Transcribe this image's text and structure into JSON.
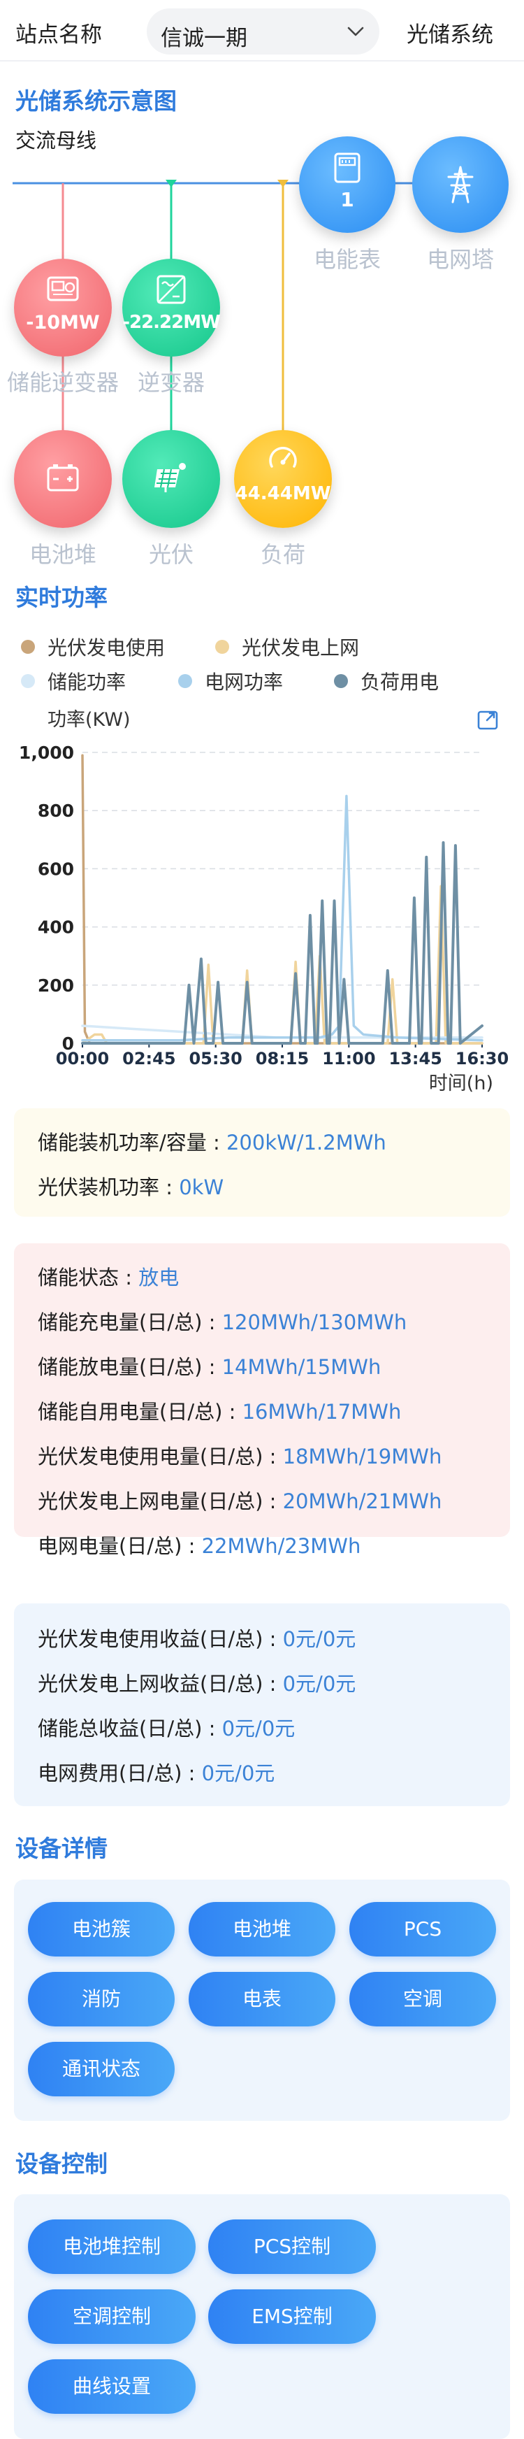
{
  "header": {
    "site_label": "站点名称",
    "site_value": "信诚一期",
    "system_label": "光储系统"
  },
  "diagram": {
    "title": "光储系统示意图",
    "bus_label": "交流母线",
    "nodes": {
      "meter": {
        "label": "电能表",
        "value": "1",
        "icon": "meter-icon",
        "color": "#3a9bf6"
      },
      "tower": {
        "label": "电网塔",
        "value": "",
        "icon": "power-tower-icon",
        "color": "#3a9bf6"
      },
      "storage_inverter": {
        "label": "储能逆变器",
        "value": "-10MW",
        "icon": "storage-inverter-icon",
        "color": "#f47b80"
      },
      "inverter": {
        "label": "逆变器",
        "value": "-22.22MW",
        "icon": "inverter-icon",
        "color": "#1fd49b"
      },
      "battery": {
        "label": "电池堆",
        "value": "",
        "icon": "battery-icon",
        "color": "#f47b80"
      },
      "pv": {
        "label": "光伏",
        "value": "",
        "icon": "solar-panel-icon",
        "color": "#1fd49b"
      },
      "load": {
        "label": "负荷",
        "value": "44.44MW",
        "icon": "gauge-icon",
        "color": "#ffbf1f"
      }
    }
  },
  "power": {
    "title": "实时功率",
    "legend": [
      {
        "name": "光伏发电使用",
        "color": "#c9a57a"
      },
      {
        "name": "光伏发电上网",
        "color": "#f0d49c"
      },
      {
        "name": "储能功率",
        "color": "#d6e9f7"
      },
      {
        "name": "电网功率",
        "color": "#a8d0ec"
      },
      {
        "name": "负荷用电",
        "color": "#6e8fa4"
      }
    ],
    "export_icon": "export-icon"
  },
  "chart_data": {
    "type": "line",
    "ylabel": "功率(KW)",
    "xlabel": "时间(h)",
    "ylim": [
      0,
      1000
    ],
    "yticks": [
      "0",
      "200",
      "400",
      "600",
      "800",
      "1,000"
    ],
    "xticks": [
      "00:00",
      "02:45",
      "05:30",
      "08:15",
      "11:00",
      "13:45",
      "16:30"
    ],
    "xlim": [
      0,
      16.5
    ],
    "grid": "horizontal-dashed",
    "series": [
      {
        "name": "光伏发电使用",
        "color": "#c9a57a",
        "points": [
          [
            0,
            990
          ],
          [
            0.1,
            40
          ],
          [
            0.3,
            0
          ],
          [
            7,
            0
          ],
          [
            16.5,
            0
          ]
        ]
      },
      {
        "name": "光伏发电上网",
        "color": "#f0d49c",
        "points": [
          [
            0,
            0
          ],
          [
            0.5,
            30
          ],
          [
            0.8,
            30
          ],
          [
            1.0,
            0
          ],
          [
            5.0,
            0
          ],
          [
            5.2,
            270
          ],
          [
            5.4,
            0
          ],
          [
            6.6,
            0
          ],
          [
            6.8,
            250
          ],
          [
            7.0,
            0
          ],
          [
            8.6,
            0
          ],
          [
            8.8,
            280
          ],
          [
            9.0,
            0
          ],
          [
            9.6,
            0
          ],
          [
            9.8,
            300
          ],
          [
            10.0,
            0
          ],
          [
            12.6,
            0
          ],
          [
            12.8,
            220
          ],
          [
            13.0,
            0
          ],
          [
            14.6,
            0
          ],
          [
            14.8,
            540
          ],
          [
            15.0,
            0
          ],
          [
            16.5,
            0
          ]
        ]
      },
      {
        "name": "储能功率",
        "color": "#d6e9f7",
        "points": [
          [
            0,
            60
          ],
          [
            2,
            50
          ],
          [
            4,
            40
          ],
          [
            6,
            30
          ],
          [
            8,
            20
          ],
          [
            10,
            20
          ],
          [
            12,
            20
          ],
          [
            14,
            20
          ],
          [
            16.5,
            20
          ]
        ]
      },
      {
        "name": "电网功率",
        "color": "#a8d0ec",
        "points": [
          [
            0,
            10
          ],
          [
            2,
            10
          ],
          [
            4,
            10
          ],
          [
            6,
            20
          ],
          [
            8,
            20
          ],
          [
            9.8,
            20
          ],
          [
            10.3,
            30
          ],
          [
            10.6,
            60
          ],
          [
            10.9,
            850
          ],
          [
            11.2,
            60
          ],
          [
            11.6,
            30
          ],
          [
            13,
            20
          ],
          [
            16.5,
            10
          ]
        ]
      },
      {
        "name": "负荷用电",
        "color": "#6e8fa4",
        "points": [
          [
            0,
            0
          ],
          [
            4.2,
            0
          ],
          [
            4.4,
            200
          ],
          [
            4.6,
            0
          ],
          [
            4.9,
            290
          ],
          [
            5.1,
            0
          ],
          [
            5.4,
            0
          ],
          [
            5.6,
            210
          ],
          [
            5.8,
            0
          ],
          [
            6.6,
            0
          ],
          [
            6.8,
            210
          ],
          [
            7.0,
            0
          ],
          [
            8.6,
            0
          ],
          [
            8.8,
            240
          ],
          [
            9.0,
            0
          ],
          [
            9.2,
            0
          ],
          [
            9.4,
            440
          ],
          [
            9.6,
            0
          ],
          [
            9.7,
            0
          ],
          [
            9.9,
            490
          ],
          [
            10.1,
            0
          ],
          [
            10.2,
            0
          ],
          [
            10.4,
            490
          ],
          [
            10.6,
            0
          ],
          [
            10.8,
            220
          ],
          [
            11.0,
            0
          ],
          [
            12.4,
            0
          ],
          [
            12.6,
            250
          ],
          [
            12.8,
            0
          ],
          [
            13.5,
            0
          ],
          [
            13.7,
            500
          ],
          [
            13.9,
            0
          ],
          [
            14.0,
            0
          ],
          [
            14.2,
            640
          ],
          [
            14.4,
            0
          ],
          [
            14.7,
            0
          ],
          [
            14.9,
            690
          ],
          [
            15.1,
            0
          ],
          [
            15.2,
            0
          ],
          [
            15.4,
            680
          ],
          [
            15.6,
            0
          ],
          [
            16.5,
            60
          ]
        ]
      }
    ]
  },
  "install_card": {
    "lines": [
      {
        "label": "储能装机功率/容量 : ",
        "value": "200kW/1.2MWh"
      },
      {
        "label": "光伏装机功率 : ",
        "value": "0kW"
      }
    ]
  },
  "energy_card": {
    "lines": [
      {
        "label": "储能状态 : ",
        "value": "放电"
      },
      {
        "label": "储能充电量(日/总) : ",
        "value": "120MWh/130MWh"
      },
      {
        "label": "储能放电量(日/总) : ",
        "value": "14MWh/15MWh"
      },
      {
        "label": "储能自用电量(日/总) : ",
        "value": "16MWh/17MWh"
      },
      {
        "label": "光伏发电使用电量(日/总) : ",
        "value": "18MWh/19MWh"
      },
      {
        "label": "光伏发电上网电量(日/总) : ",
        "value": "20MWh/21MWh"
      },
      {
        "label": "电网电量(日/总) : ",
        "value": "22MWh/23MWh"
      }
    ]
  },
  "income_card": {
    "lines": [
      {
        "label": "光伏发电使用收益(日/总) : ",
        "value": "0元/0元"
      },
      {
        "label": "光伏发电上网收益(日/总) : ",
        "value": "0元/0元"
      },
      {
        "label": "储能总收益(日/总) : ",
        "value": "0元/0元"
      },
      {
        "label": "电网费用(日/总) : ",
        "value": "0元/0元"
      }
    ]
  },
  "device_details": {
    "title": "设备详情",
    "buttons": [
      "电池簇",
      "电池堆",
      "PCS",
      "消防",
      "电表",
      "空调",
      "通讯状态"
    ]
  },
  "device_control": {
    "title": "设备控制",
    "buttons": [
      "电池堆控制",
      "PCS控制",
      "空调控制",
      "EMS控制",
      "曲线设置"
    ]
  }
}
